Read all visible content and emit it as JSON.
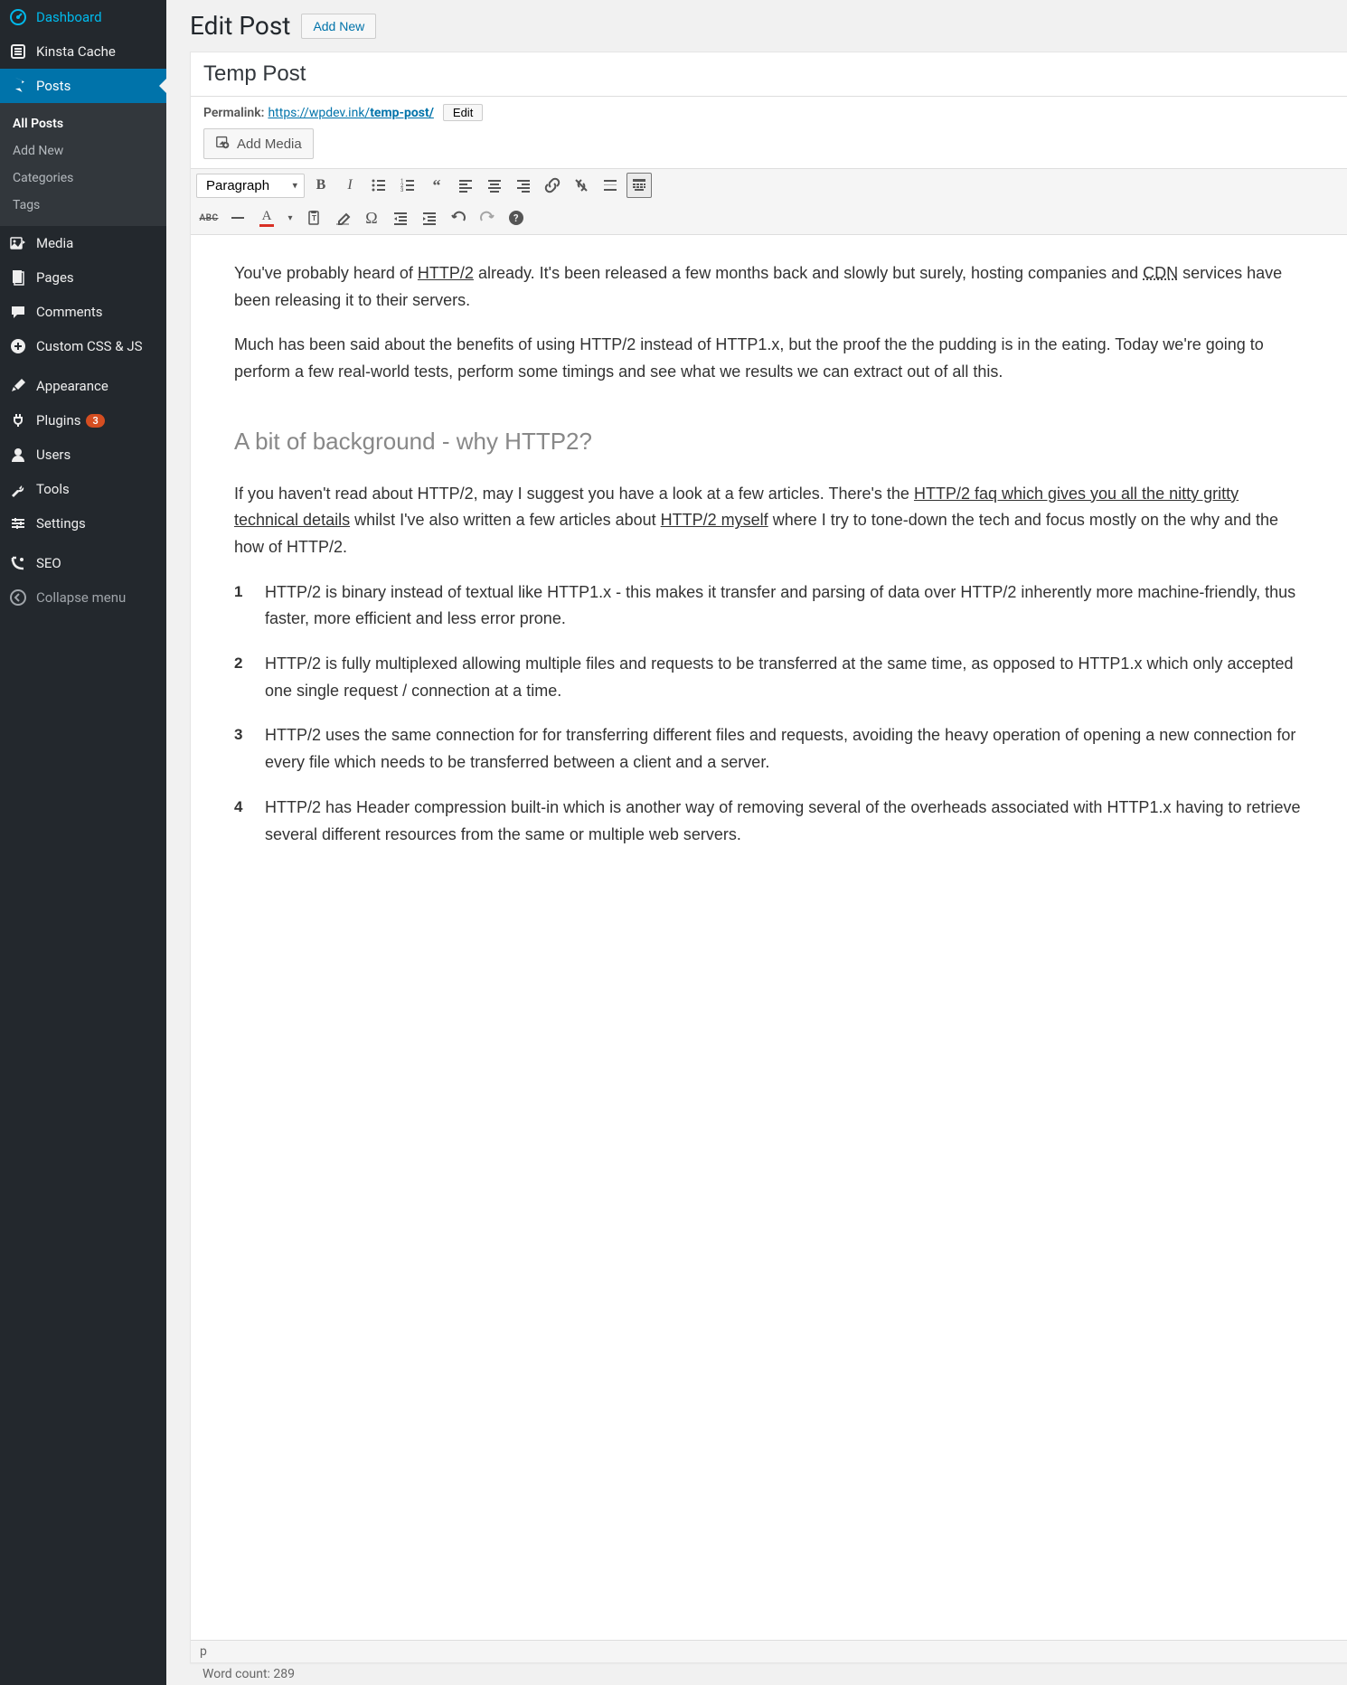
{
  "sidebar": {
    "items": [
      {
        "label": "Dashboard",
        "icon": "dashboard"
      },
      {
        "label": "Kinsta Cache",
        "icon": "kinsta"
      },
      {
        "label": "Posts",
        "icon": "pin",
        "active": true
      },
      {
        "label": "Media",
        "icon": "media"
      },
      {
        "label": "Pages",
        "icon": "page"
      },
      {
        "label": "Comments",
        "icon": "comment"
      },
      {
        "label": "Custom CSS & JS",
        "icon": "plus"
      },
      {
        "label": "Appearance",
        "icon": "brush",
        "sep_before": true
      },
      {
        "label": "Plugins",
        "icon": "plug",
        "badge": "3"
      },
      {
        "label": "Users",
        "icon": "user"
      },
      {
        "label": "Tools",
        "icon": "wrench"
      },
      {
        "label": "Settings",
        "icon": "sliders"
      },
      {
        "label": "SEO",
        "icon": "seo",
        "sep_before": true
      }
    ],
    "submenu": [
      {
        "label": "All Posts",
        "current": true
      },
      {
        "label": "Add New"
      },
      {
        "label": "Categories"
      },
      {
        "label": "Tags"
      }
    ],
    "collapse_label": "Collapse menu"
  },
  "header": {
    "title": "Edit Post",
    "add_new": "Add New"
  },
  "post": {
    "title": "Temp Post",
    "permalink_label": "Permalink:",
    "permalink_base": "https://wpdev.ink/",
    "permalink_slug": "temp-post/",
    "permalink_edit": "Edit"
  },
  "media_button": "Add Media",
  "toolbar": {
    "format": "Paragraph"
  },
  "content": {
    "p1a": "You've probably heard of ",
    "p1_link1": "HTTP/2",
    "p1b": " already. It's been released a few months back and slowly but surely, hosting companies and ",
    "p1_link2": "CDN",
    "p1c": " services have been releasing it to their servers.",
    "p2": "Much has been said about the benefits of using HTTP/2 instead of HTTP1.x, but the proof the the pudding is in the eating. Today we're going to perform a few real-world tests, perform some timings and see what we results we can extract out of all this.",
    "h2": "A bit of background - why HTTP2?",
    "p3a": "If you haven't read about HTTP/2, may I suggest you have a look at a few articles. There's the ",
    "p3_link1": "HTTP/2 faq which gives you all the nitty gritty technical details",
    "p3b": " whilst I've also written a few articles about ",
    "p3_link2": "HTTP/2 myself",
    "p3c": " where I try to tone-down the tech and focus mostly on the why and the how of HTTP/2.",
    "list": [
      "HTTP/2 is binary instead of textual like HTTP1.x - this makes it transfer and parsing of data over HTTP/2 inherently more machine-friendly, thus faster, more efficient and less error prone.",
      "HTTP/2 is fully multiplexed allowing multiple files and requests to be transferred at the same time, as opposed to HTTP1.x which only accepted one single request / connection at a time.",
      "HTTP/2 uses the same connection for for transferring different files and requests, avoiding the heavy operation of opening a new connection for every file which needs to be transferred between a client and a server.",
      "HTTP/2 has Header compression built-in which is another way of removing several of the overheads associated with HTTP1.x having to retrieve several different resources from the same or multiple web servers."
    ]
  },
  "status": {
    "path": "p",
    "word_count_label": "Word count: ",
    "word_count": "289"
  }
}
